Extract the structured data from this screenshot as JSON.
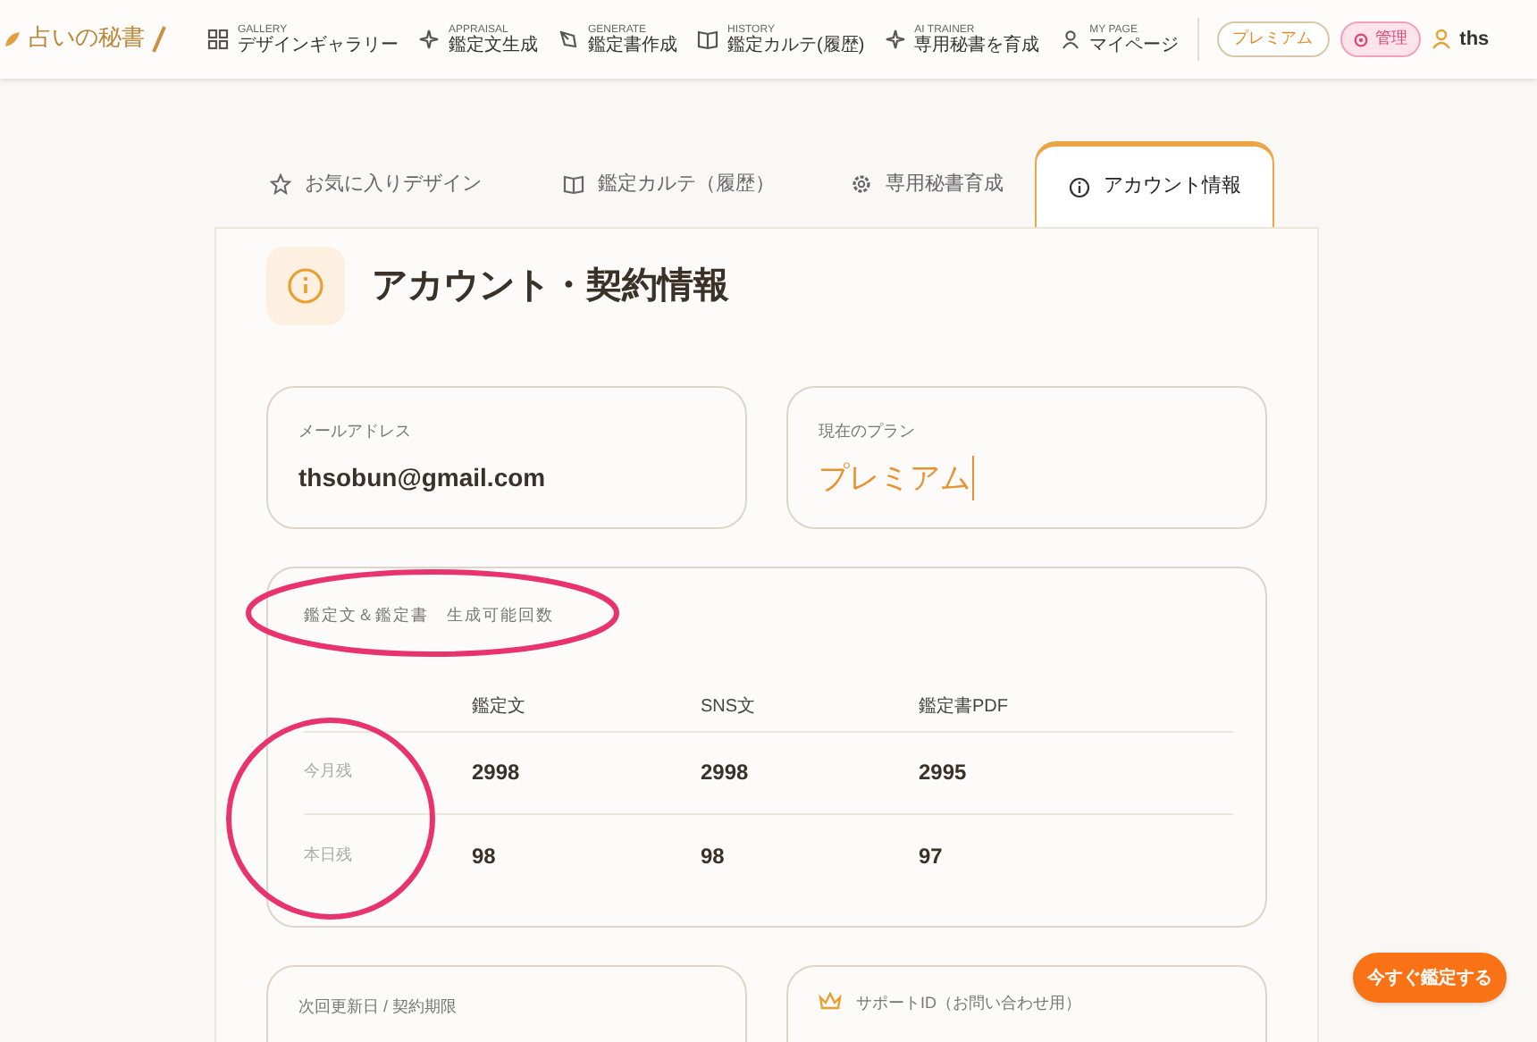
{
  "header": {
    "logo": "占いの秘書",
    "nav": [
      {
        "caption": "GALLERY",
        "label": "デザインギャラリー",
        "kind": "grid"
      },
      {
        "caption": "APPRAISAL",
        "label": "鑑定文生成",
        "kind": "sparkle"
      },
      {
        "caption": "GENERATE",
        "label": "鑑定書作成",
        "kind": "pen"
      },
      {
        "caption": "HISTORY",
        "label": "鑑定カルテ(履歴)",
        "kind": "book"
      },
      {
        "caption": "AI TRAINER",
        "label": "専用秘書を育成",
        "kind": "sparkle"
      },
      {
        "caption": "MY PAGE",
        "label": "マイページ",
        "kind": "user"
      }
    ],
    "plan_badge": "プレミアム",
    "admin_button": "管理",
    "user_name": "ths"
  },
  "tabs": [
    {
      "label": "お気に入りデザイン",
      "kind": "star",
      "selected": false
    },
    {
      "label": "鑑定カルテ（履歴）",
      "kind": "book",
      "selected": false
    },
    {
      "label": "専用秘書育成",
      "kind": "gear",
      "selected": false
    },
    {
      "label": "アカウント情報",
      "kind": "info",
      "selected": true
    }
  ],
  "section_title": "アカウント・契約情報",
  "email": {
    "label": "メールアドレス",
    "value": "thsobun@gmail.com"
  },
  "plan": {
    "label": "現在のプラン",
    "value": "プレミアム"
  },
  "quota": {
    "title": "鑑定文＆鑑定書　生成可能回数",
    "columns": [
      "鑑定文",
      "SNS文",
      "鑑定書PDF"
    ],
    "rows": [
      {
        "label": "今月残",
        "values": [
          "2998",
          "2998",
          "2995"
        ]
      },
      {
        "label": "本日残",
        "values": [
          "98",
          "98",
          "97"
        ]
      }
    ]
  },
  "renewal": {
    "label": "次回更新日 / 契約期限"
  },
  "support": {
    "label": "サポートID（お問い合わせ用）"
  },
  "floating_button": "今すぐ鑑定する"
}
